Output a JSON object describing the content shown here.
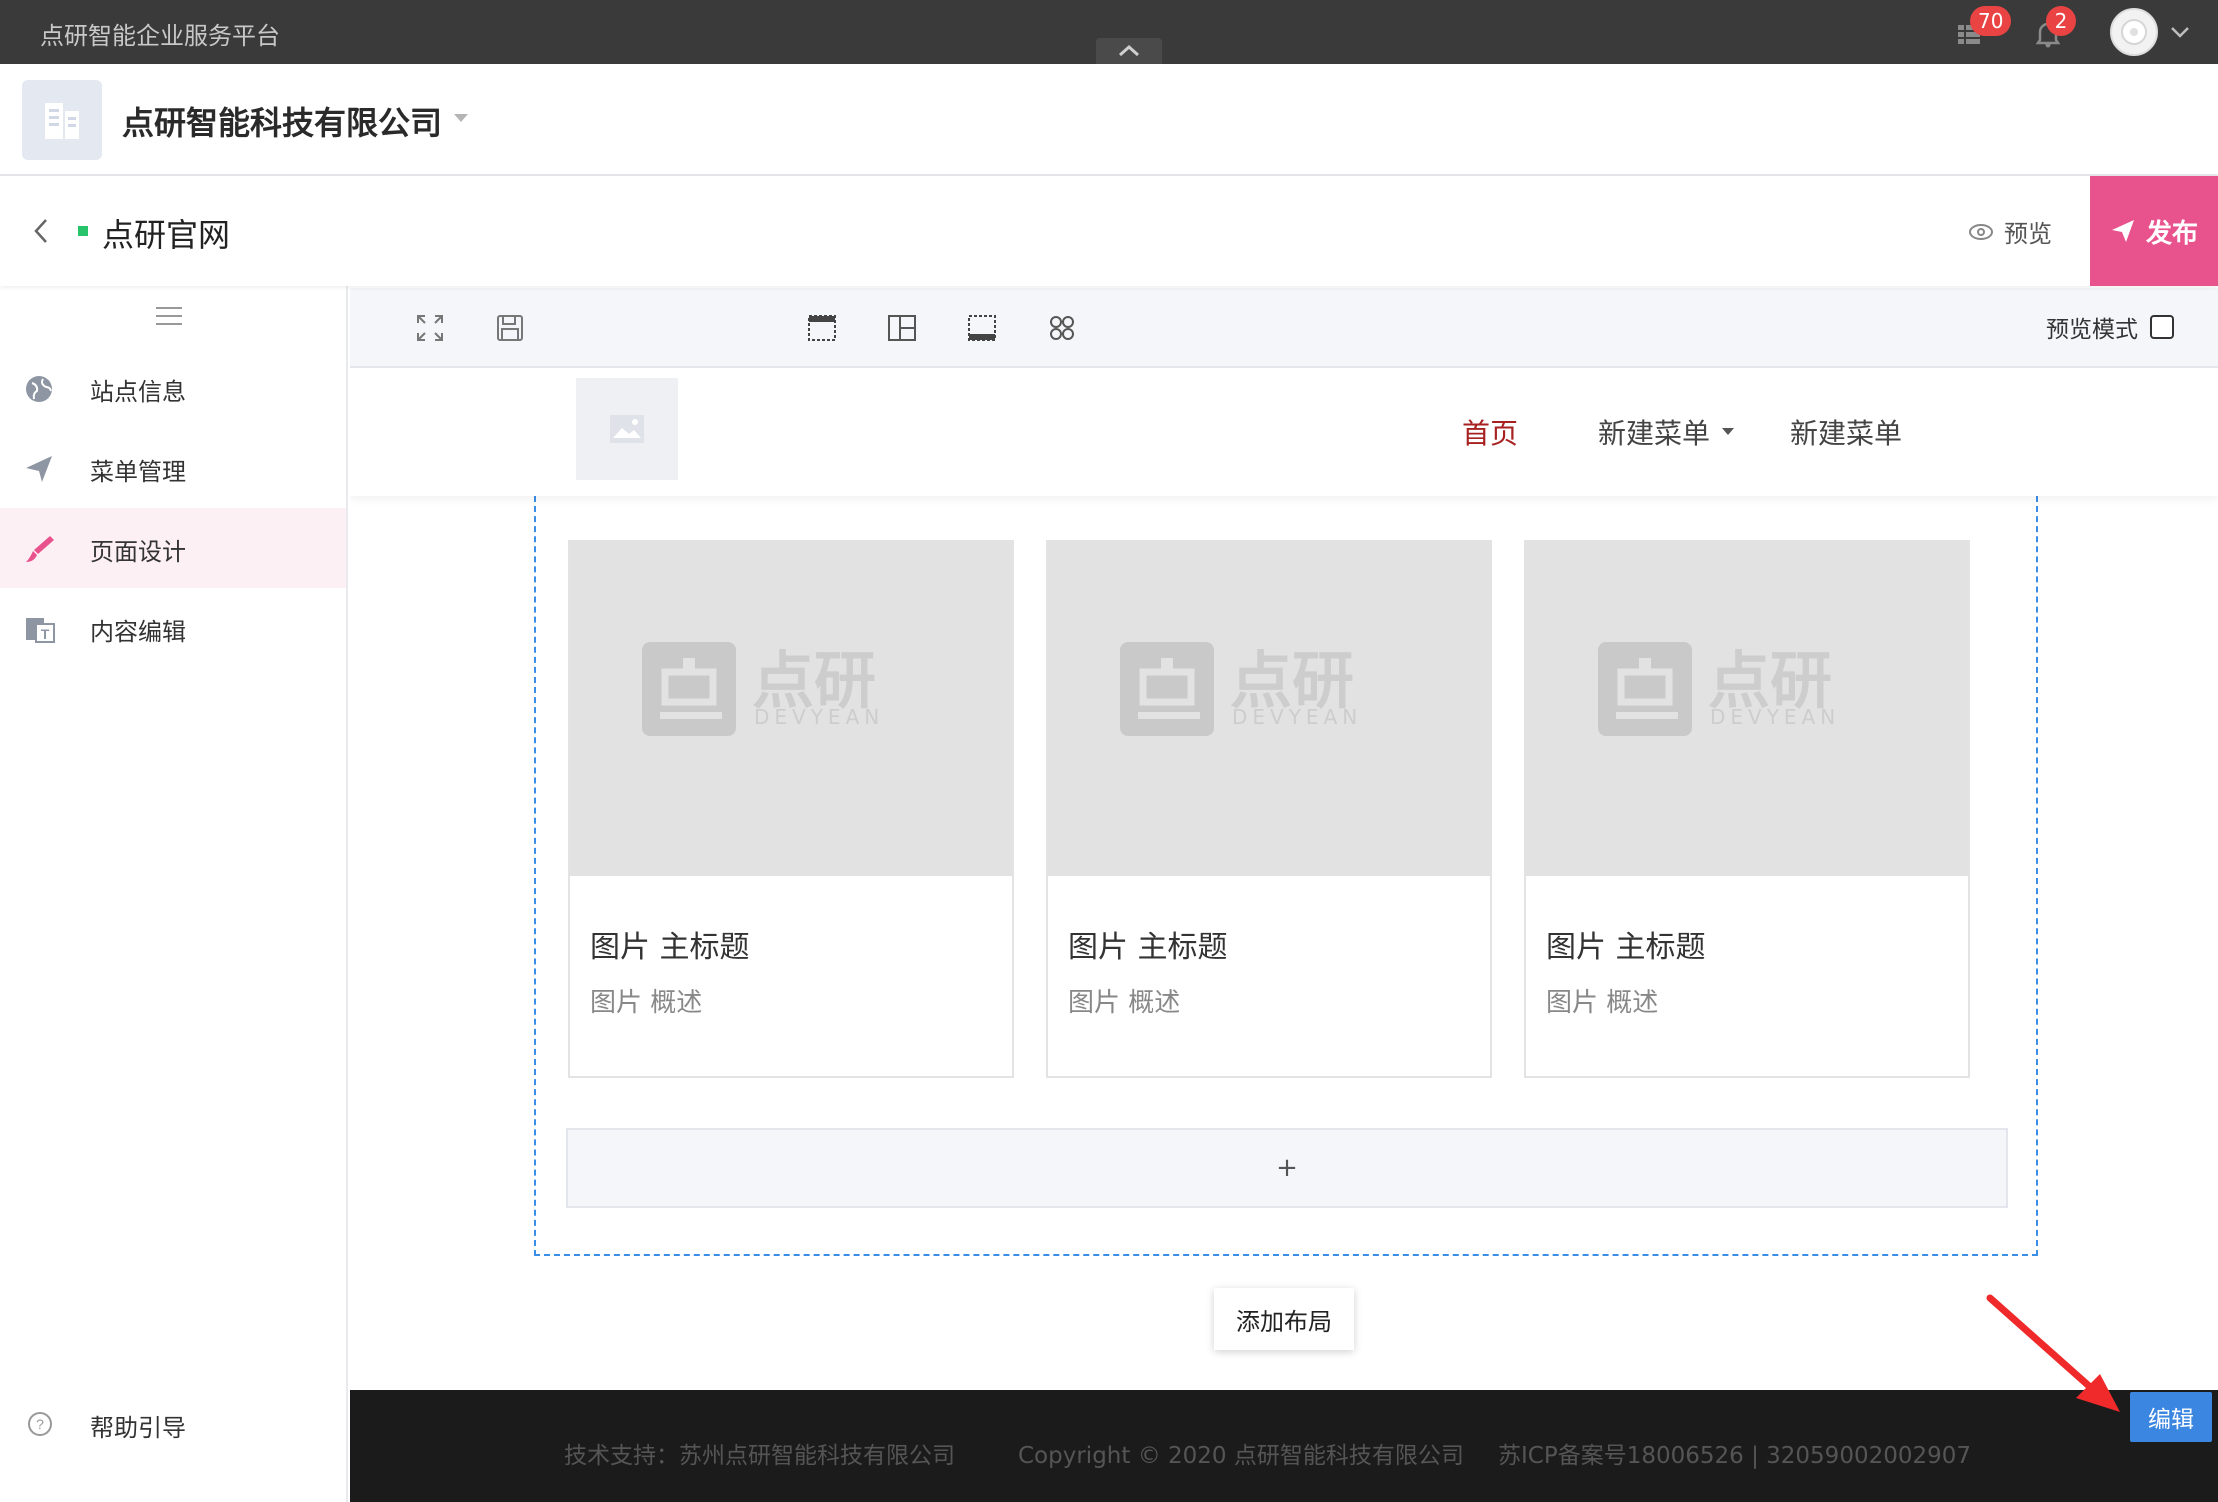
{
  "topbar": {
    "platform_title": "点研智能企业服务平台",
    "tasks_badge": "70",
    "notifications_badge": "2"
  },
  "company": {
    "name": "点研智能科技有限公司"
  },
  "site": {
    "name": "点研官网",
    "status_color": "#27c46b",
    "preview_label": "预览",
    "publish_label": "发布"
  },
  "sidebar": {
    "items": [
      {
        "label": "站点信息",
        "icon": "globe-icon"
      },
      {
        "label": "菜单管理",
        "icon": "send-icon"
      },
      {
        "label": "页面设计",
        "icon": "brush-icon",
        "active": true
      },
      {
        "label": "内容编辑",
        "icon": "text-edit-icon"
      }
    ],
    "help_label": "帮助引导"
  },
  "toolbar": {
    "preview_mode_label": "预览模式",
    "preview_mode_checked": false
  },
  "canvas": {
    "menu": {
      "home": "首页",
      "new_menu_dropdown": "新建菜单",
      "new_menu": "新建菜单"
    },
    "watermark": {
      "brand_cn": "点研",
      "brand_en": "DEVYEAN"
    },
    "cards": [
      {
        "title": "图片 主标题",
        "desc": "图片 概述"
      },
      {
        "title": "图片 主标题",
        "desc": "图片 概述"
      },
      {
        "title": "图片 主标题",
        "desc": "图片 概述"
      }
    ],
    "add_row_label": "+",
    "add_layout_label": "添加布局"
  },
  "footer": {
    "support": "技术支持：苏州点研智能科技有限公司",
    "copyright": "Copyright © 2020 点研智能科技有限公司",
    "icp": "苏ICP备案号18006526 | 32059002002907"
  },
  "edit_label": "编辑",
  "colors": {
    "accent_pink": "#e9538d",
    "menu_active": "#a82121",
    "edit_blue": "#3b86e0",
    "dashed_border": "#3a8ee6"
  }
}
